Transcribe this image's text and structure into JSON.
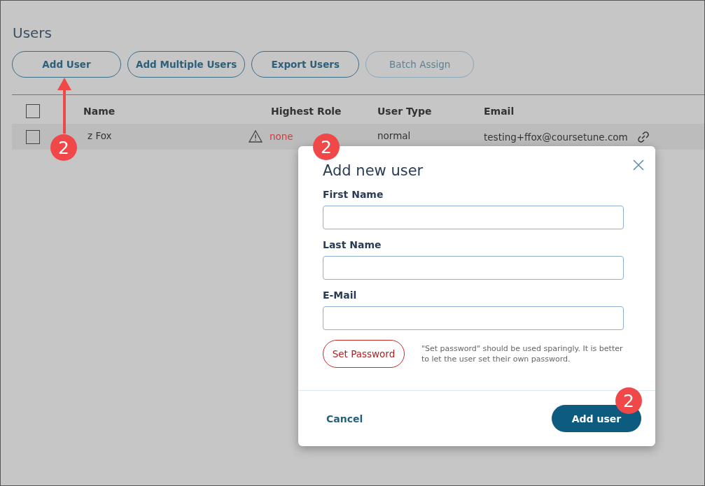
{
  "page": {
    "title": "Users"
  },
  "toolbar": [
    {
      "label": "Add User",
      "disabled": false
    },
    {
      "label": "Add Multiple Users",
      "disabled": false
    },
    {
      "label": "Export Users",
      "disabled": false
    },
    {
      "label": "Batch Assign",
      "disabled": true
    }
  ],
  "table": {
    "all_checked": false,
    "columns": [
      "Name",
      "Highest Role",
      "User Type",
      "Email"
    ],
    "rows": [
      {
        "checked": false,
        "name": "z Fox",
        "role": "none",
        "role_missing": true,
        "user_type": "normal",
        "email": "testing+ffox@coursetune.com"
      }
    ]
  },
  "dialog": {
    "title": "Add new user",
    "fields": [
      {
        "label": "First Name"
      },
      {
        "label": "Last Name"
      },
      {
        "label": "E-Mail"
      }
    ],
    "set_password": "Set Password",
    "hint": "\"Set password\" should be used sparingly. It is better to let the user set their own password.",
    "cancel": "Cancel",
    "submit": "Add user"
  },
  "callouts": [
    {
      "label": "2"
    },
    {
      "label": "2"
    },
    {
      "label": "2"
    }
  ]
}
